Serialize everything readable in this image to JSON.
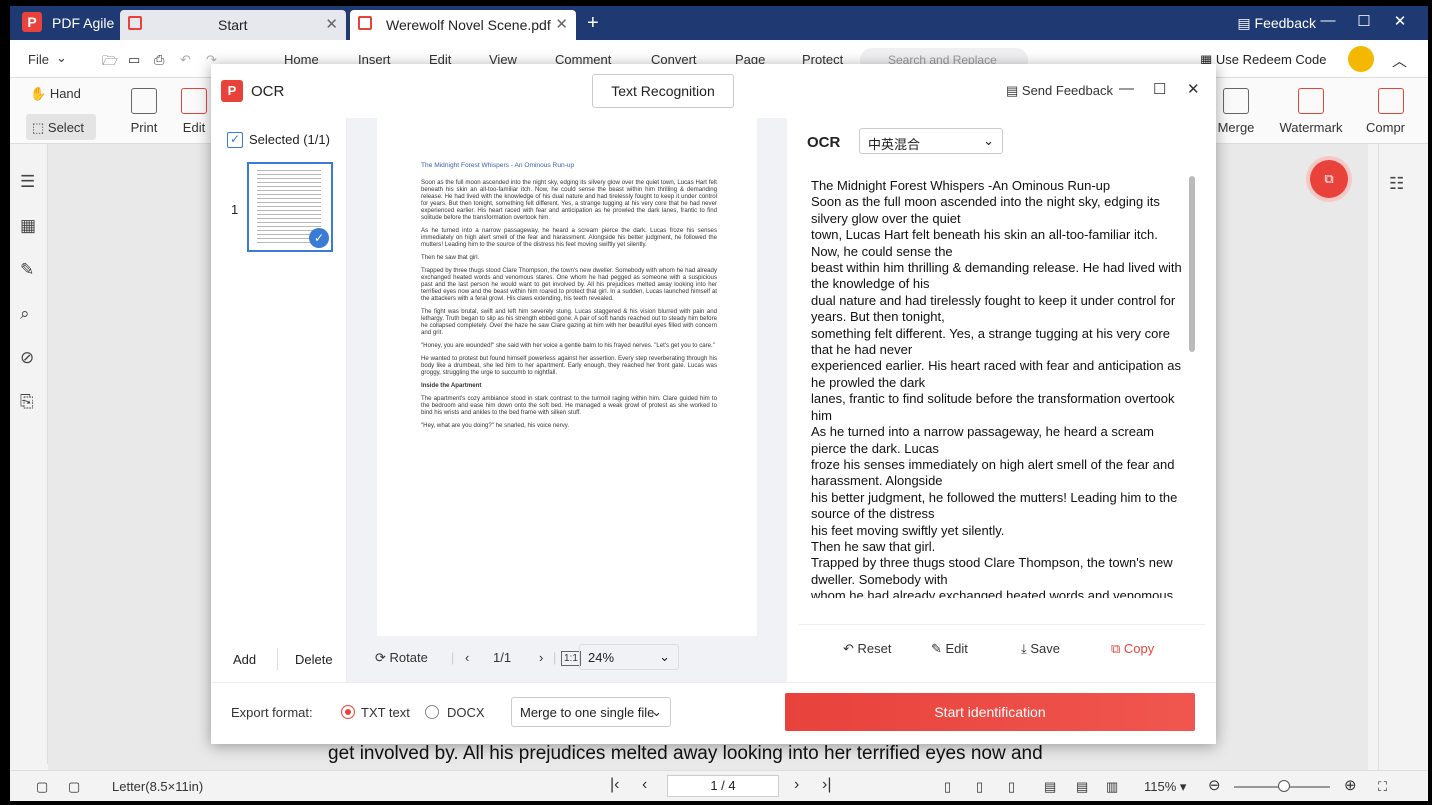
{
  "app": {
    "name": "PDF Agile"
  },
  "tabs": [
    {
      "label": "Start"
    },
    {
      "label": "Werewolf Novel Scene.pdf"
    }
  ],
  "titlebar": {
    "feedback": "Feedback"
  },
  "menu": {
    "file": "File",
    "items": [
      "Home",
      "Insert",
      "Edit",
      "View",
      "Comment",
      "Convert",
      "Page",
      "Protect"
    ],
    "search_placeholder": "Search and Replace",
    "redeem": "Use Redeem Code"
  },
  "ribbon": {
    "hand": "Hand",
    "select": "Select",
    "print": "Print",
    "edit": "Edit",
    "merge": "Merge",
    "watermark": "Watermark",
    "compress": "Compr"
  },
  "background_text": "get involved by. All his prejudices melted away looking into her terrified eyes now and",
  "statusbar": {
    "paper": "Letter(8.5×11in)",
    "page": "1 / 4",
    "zoom": "115%"
  },
  "ocr_dialog": {
    "title": "OCR",
    "text_recognition": "Text Recognition",
    "send_feedback": "Send Feedback",
    "selected": "Selected (1/1)",
    "page_number": "1",
    "add": "Add",
    "delete": "Delete",
    "rotate": "Rotate",
    "page_indicator": "1/1",
    "fit": "1:1",
    "zoom": "24%",
    "ocr_label": "OCR",
    "language": "中英混合",
    "reset": "Reset",
    "edit": "Edit",
    "save": "Save",
    "copy": "Copy",
    "export_label": "Export format:",
    "format_txt": "TXT text",
    "format_docx": "DOCX",
    "merge_option": "Merge to one single file",
    "start": "Start identification",
    "ocr_lines": [
      "The Midnight Forest Whispers -An Ominous Run-up",
      "Soon as the full moon ascended into the night sky, edging its silvery glow over the quiet",
      "town, Lucas Hart felt beneath his skin an all-too-familiar itch. Now, he could sense the",
      "beast within him thrilling & demanding release. He had lived with the knowledge of his",
      "dual nature and had tirelessly fought to keep it under control for years. But then tonight,",
      "something felt different. Yes, a strange tugging at his very core that he had never",
      "experienced earlier. His heart raced with fear and anticipation as he prowled the dark",
      "lanes, frantic to find solitude before the transformation overtook him",
      "As he turned into a narrow passageway, he heard a scream pierce the dark. Lucas",
      "froze his senses immediately on high alert smell of the fear and harassment. Alongside",
      "his better judgment, he followed the mutters! Leading him to the source of the distress",
      "his feet moving swiftly yet silently.",
      "Then he saw that girl.",
      "Trapped by three thugs stood Clare Thompson, the town's new dweller. Somebody with",
      "whom he had already exchanged heated words and venomous"
    ],
    "preview": {
      "title": "The Midnight Forest Whispers - An Ominous Run-up",
      "paragraphs": [
        "Soon as the full moon ascended into the night sky, edging its silvery glow over the quiet town, Lucas Hart felt beneath his skin an all-too-familiar itch. Now, he could sense the beast within him thrilling & demanding release. He had lived with the knowledge of his dual nature and had tirelessly fought to keep it under control for years. But then tonight, something felt different. Yes, a strange tugging at his very core that he had never experienced earlier. His heart raced with fear and anticipation as he prowled the dark lanes, frantic to find solitude before the transformation overtook him.",
        "As he turned into a narrow passageway, he heard a scream pierce the dark. Lucas froze his senses immediately on high alert smell of the fear and harassment. Alongside his better judgment, he followed the mutters! Leading him to the source of the distress his feet moving swiftly yet silently.",
        "Then he saw that girl.",
        "Trapped by three thugs stood Clare Thompson, the town's new dweller. Somebody with whom he had already exchanged heated words and venomous stares. One whom he had pegged as someone with a suspicious past and the last person he would want to get involved by. All his prejudices melted away looking into her terrified eyes now and the beast within him roared to protect that girl. In a sudden, Lucas launched himself at the attackers with a feral growl. His claws extending, his teeth revealed.",
        "The fight was brutal, swift and left him severely stung. Lucas staggered & his vision blurred with pain and lethargy. Truth began to slip as his strength ebbed gone. A pair of soft hands reached out to steady him before he collapsed completely. Over the haze he saw Clare gazing at him with her beautiful eyes filled with concern and grit.",
        "\"Honey, you are wounded!\" she said with her voice a gentle balm to his frayed nerves. \"Let's get you to care.\"",
        "He wanted to protest but found himself powerless against her assertion. Every step reverberating through his body like a drumbeat, she led him to her apartment. Early enough, they reached her front gate. Lucas was groggy, struggling the urge to succumb to nightfall."
      ],
      "heading": "Inside the Apartment",
      "paragraphs2": [
        "The apartment's cozy ambiance stood in stark contrast to the turmoil raging within him. Clare guided him to the bedroom and ease him down onto the soft bed. He managed a weak growl of protest as she worked to bind his wrists and ankles to the bed frame with silken stuff.",
        "\"Hey, what are you doing?\" he snarled, his voice nervy."
      ]
    }
  }
}
